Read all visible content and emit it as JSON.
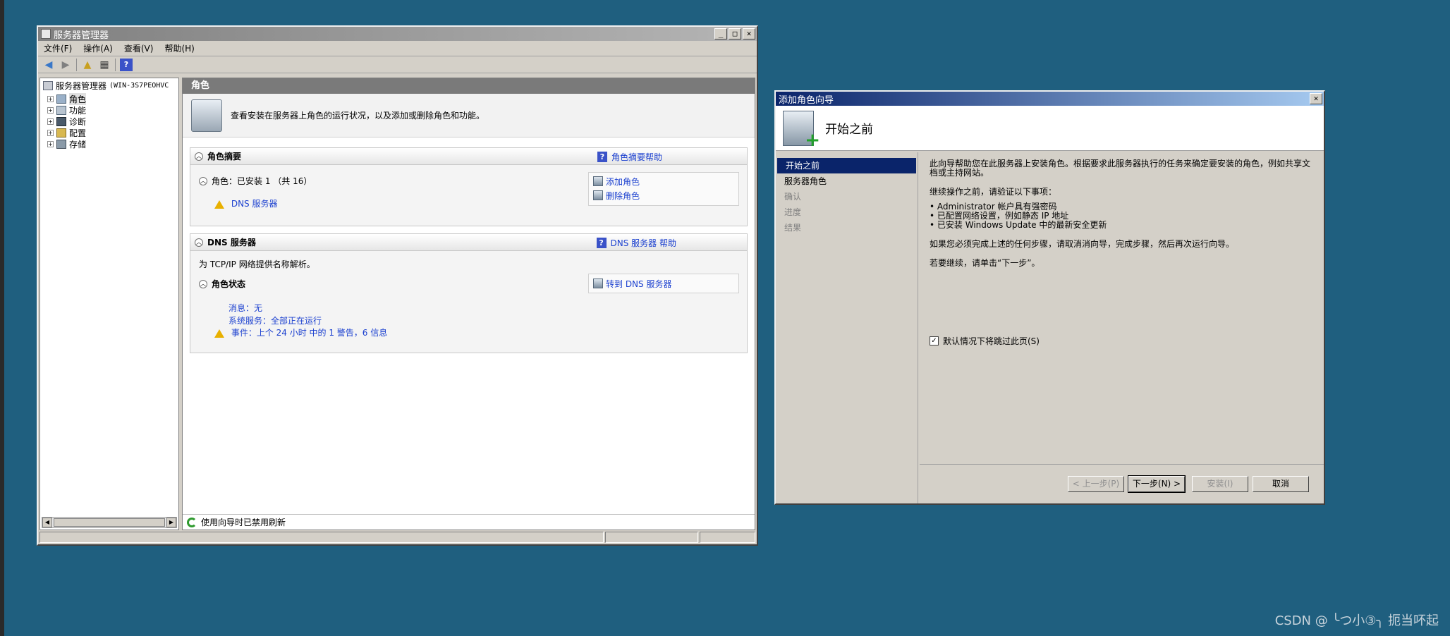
{
  "server_manager": {
    "window_title": "服务器管理器",
    "window_buttons": {
      "minimize": "_",
      "maximize": "□",
      "close": "✕"
    },
    "menu": [
      "文件(F)",
      "操作(A)",
      "查看(V)",
      "帮助(H)"
    ],
    "tree": {
      "root_label": "服务器管理器",
      "root_host": "(WIN-3S7PEOHVC",
      "items": [
        "角色",
        "功能",
        "诊断",
        "配置",
        "存储"
      ]
    },
    "main": {
      "header": "角色",
      "intro": "查看安装在服务器上角色的运行状况，以及添加或删除角色和功能。",
      "summary": {
        "title": "角色摘要",
        "help": "角色摘要帮助",
        "roles_label": "角色：已安装 1 （共 16）",
        "role_item": "DNS 服务器",
        "actions": [
          "添加角色",
          "删除角色"
        ]
      },
      "dns": {
        "title": "DNS 服务器",
        "help": "DNS 服务器 帮助",
        "description": "为 TCP/IP 网络提供名称解析。",
        "status_label": "角色状态",
        "goto": "转到 DNS 服务器",
        "messages": "消息：无",
        "services": "系统服务：全部正在运行",
        "events": "事件：上个 24 小时 中的 1 警告，6 信息"
      },
      "refresh_text": "使用向导时已禁用刷新"
    }
  },
  "wizard": {
    "window_title": "添加角色向导",
    "close": "✕",
    "heading": "开始之前",
    "steps": [
      "开始之前",
      "服务器角色",
      "确认",
      "进度",
      "结果"
    ],
    "intro": "此向导帮助您在此服务器上安装角色。根据要求此服务器执行的任务来确定要安装的角色，例如共享文档或主持网站。",
    "before_text": "继续操作之前，请验证以下事项：",
    "checklist": [
      "Administrator 帐户具有强密码",
      "已配置网络设置，例如静态 IP 地址",
      "已安装 Windows Update 中的最新安全更新"
    ],
    "cancel_note": "如果您必须完成上述的任何步骤，请取消消向导，完成步骤，然后再次运行向导。",
    "continue_note": "若要继续，请单击“下一步”。",
    "skip_label": "默认情况下将跳过此页(S)",
    "buttons": {
      "prev": "< 上一步(P)",
      "next": "下一步(N) >",
      "install": "安装(I)",
      "cancel": "取消"
    }
  },
  "watermark": "CSDN @ ╰つ小③╮ 扼当吥起"
}
